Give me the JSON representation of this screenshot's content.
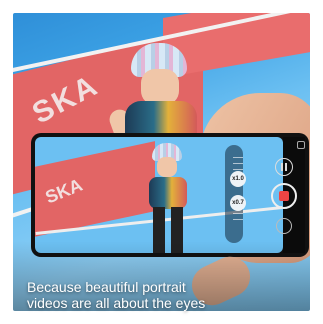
{
  "caption": {
    "line1": "Because beautiful portrait",
    "line2": "videos are all about the eyes"
  },
  "camera_ui": {
    "zoom_upper": "x1.0",
    "zoom_lower": "x0.7"
  },
  "colors": {
    "court_blue": "#6cc0f2",
    "court_red": "#e26565",
    "record_red": "#e44444"
  },
  "icons": [
    "pause-icon",
    "record-icon",
    "camera-switch-icon",
    "settings-icon"
  ]
}
